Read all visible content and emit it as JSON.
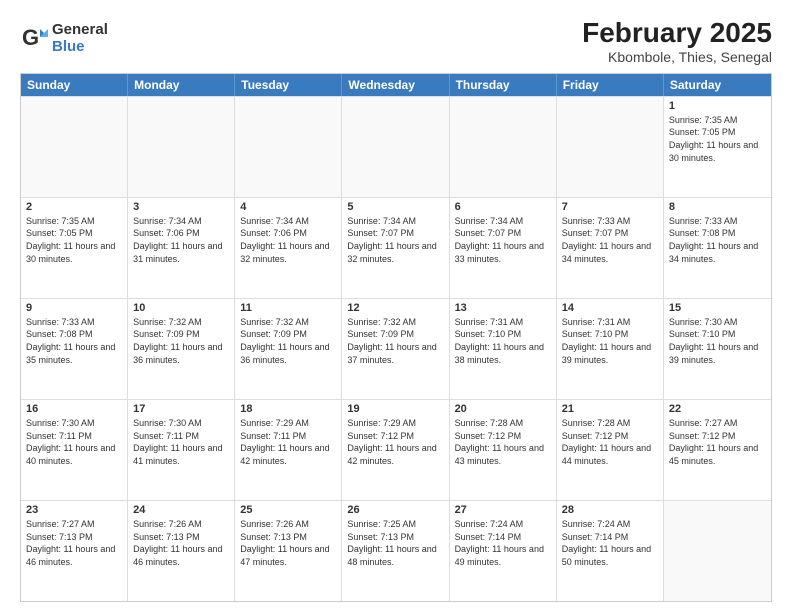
{
  "logo": {
    "general": "General",
    "blue": "Blue"
  },
  "title": {
    "main": "February 2025",
    "sub": "Kbombole, Thies, Senegal"
  },
  "headers": [
    "Sunday",
    "Monday",
    "Tuesday",
    "Wednesday",
    "Thursday",
    "Friday",
    "Saturday"
  ],
  "weeks": [
    [
      {
        "day": "",
        "info": ""
      },
      {
        "day": "",
        "info": ""
      },
      {
        "day": "",
        "info": ""
      },
      {
        "day": "",
        "info": ""
      },
      {
        "day": "",
        "info": ""
      },
      {
        "day": "",
        "info": ""
      },
      {
        "day": "1",
        "info": "Sunrise: 7:35 AM\nSunset: 7:05 PM\nDaylight: 11 hours and 30 minutes."
      }
    ],
    [
      {
        "day": "2",
        "info": "Sunrise: 7:35 AM\nSunset: 7:05 PM\nDaylight: 11 hours and 30 minutes."
      },
      {
        "day": "3",
        "info": "Sunrise: 7:34 AM\nSunset: 7:06 PM\nDaylight: 11 hours and 31 minutes."
      },
      {
        "day": "4",
        "info": "Sunrise: 7:34 AM\nSunset: 7:06 PM\nDaylight: 11 hours and 32 minutes."
      },
      {
        "day": "5",
        "info": "Sunrise: 7:34 AM\nSunset: 7:07 PM\nDaylight: 11 hours and 32 minutes."
      },
      {
        "day": "6",
        "info": "Sunrise: 7:34 AM\nSunset: 7:07 PM\nDaylight: 11 hours and 33 minutes."
      },
      {
        "day": "7",
        "info": "Sunrise: 7:33 AM\nSunset: 7:07 PM\nDaylight: 11 hours and 34 minutes."
      },
      {
        "day": "8",
        "info": "Sunrise: 7:33 AM\nSunset: 7:08 PM\nDaylight: 11 hours and 34 minutes."
      }
    ],
    [
      {
        "day": "9",
        "info": "Sunrise: 7:33 AM\nSunset: 7:08 PM\nDaylight: 11 hours and 35 minutes."
      },
      {
        "day": "10",
        "info": "Sunrise: 7:32 AM\nSunset: 7:09 PM\nDaylight: 11 hours and 36 minutes."
      },
      {
        "day": "11",
        "info": "Sunrise: 7:32 AM\nSunset: 7:09 PM\nDaylight: 11 hours and 36 minutes."
      },
      {
        "day": "12",
        "info": "Sunrise: 7:32 AM\nSunset: 7:09 PM\nDaylight: 11 hours and 37 minutes."
      },
      {
        "day": "13",
        "info": "Sunrise: 7:31 AM\nSunset: 7:10 PM\nDaylight: 11 hours and 38 minutes."
      },
      {
        "day": "14",
        "info": "Sunrise: 7:31 AM\nSunset: 7:10 PM\nDaylight: 11 hours and 39 minutes."
      },
      {
        "day": "15",
        "info": "Sunrise: 7:30 AM\nSunset: 7:10 PM\nDaylight: 11 hours and 39 minutes."
      }
    ],
    [
      {
        "day": "16",
        "info": "Sunrise: 7:30 AM\nSunset: 7:11 PM\nDaylight: 11 hours and 40 minutes."
      },
      {
        "day": "17",
        "info": "Sunrise: 7:30 AM\nSunset: 7:11 PM\nDaylight: 11 hours and 41 minutes."
      },
      {
        "day": "18",
        "info": "Sunrise: 7:29 AM\nSunset: 7:11 PM\nDaylight: 11 hours and 42 minutes."
      },
      {
        "day": "19",
        "info": "Sunrise: 7:29 AM\nSunset: 7:12 PM\nDaylight: 11 hours and 42 minutes."
      },
      {
        "day": "20",
        "info": "Sunrise: 7:28 AM\nSunset: 7:12 PM\nDaylight: 11 hours and 43 minutes."
      },
      {
        "day": "21",
        "info": "Sunrise: 7:28 AM\nSunset: 7:12 PM\nDaylight: 11 hours and 44 minutes."
      },
      {
        "day": "22",
        "info": "Sunrise: 7:27 AM\nSunset: 7:12 PM\nDaylight: 11 hours and 45 minutes."
      }
    ],
    [
      {
        "day": "23",
        "info": "Sunrise: 7:27 AM\nSunset: 7:13 PM\nDaylight: 11 hours and 46 minutes."
      },
      {
        "day": "24",
        "info": "Sunrise: 7:26 AM\nSunset: 7:13 PM\nDaylight: 11 hours and 46 minutes."
      },
      {
        "day": "25",
        "info": "Sunrise: 7:26 AM\nSunset: 7:13 PM\nDaylight: 11 hours and 47 minutes."
      },
      {
        "day": "26",
        "info": "Sunrise: 7:25 AM\nSunset: 7:13 PM\nDaylight: 11 hours and 48 minutes."
      },
      {
        "day": "27",
        "info": "Sunrise: 7:24 AM\nSunset: 7:14 PM\nDaylight: 11 hours and 49 minutes."
      },
      {
        "day": "28",
        "info": "Sunrise: 7:24 AM\nSunset: 7:14 PM\nDaylight: 11 hours and 50 minutes."
      },
      {
        "day": "",
        "info": ""
      }
    ]
  ]
}
